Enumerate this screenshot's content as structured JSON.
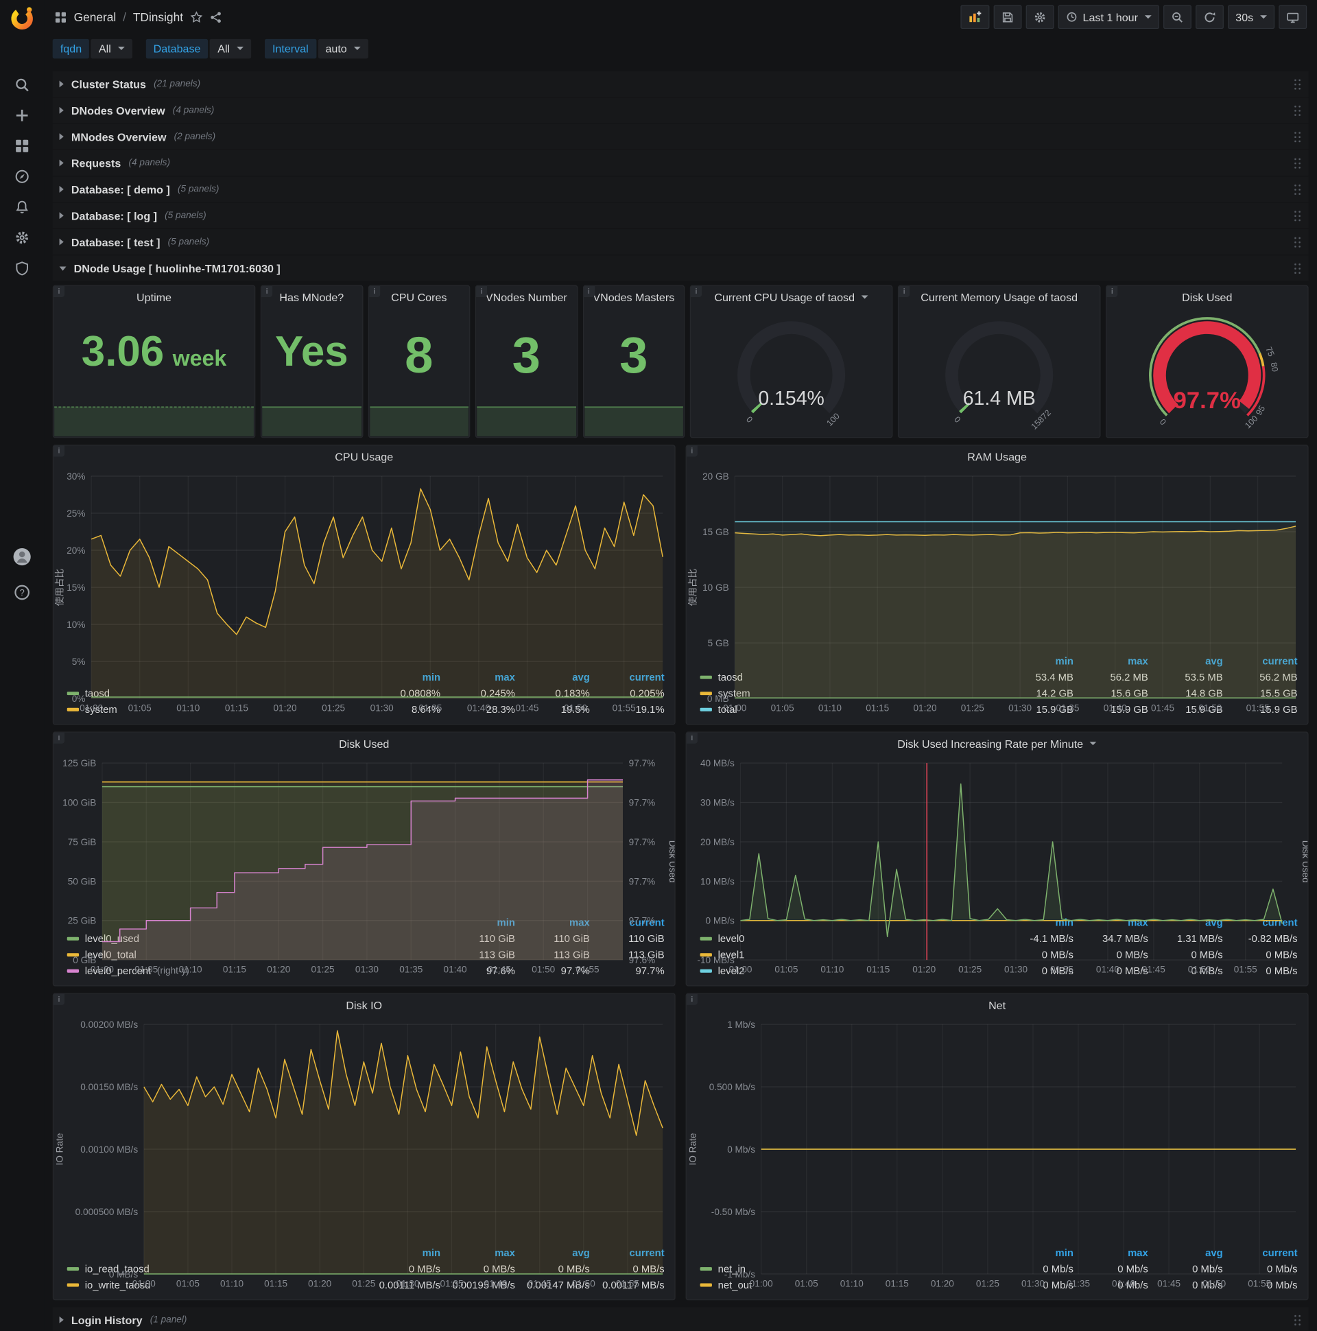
{
  "ui": {
    "info_icon": "i"
  },
  "navbar": {
    "breadcrumb": {
      "section": "General",
      "separator": "/",
      "title": "TDinsight"
    },
    "time_range": "Last 1 hour",
    "refresh_interval": "30s"
  },
  "variables": [
    {
      "label": "fqdn",
      "value": "All"
    },
    {
      "label": "Database",
      "value": "All"
    },
    {
      "label": "Interval",
      "value": "auto"
    }
  ],
  "rows": [
    {
      "title": "Cluster Status",
      "panels": "(21 panels)"
    },
    {
      "title": "DNodes Overview",
      "panels": "(4 panels)"
    },
    {
      "title": "MNodes Overview",
      "panels": "(2 panels)"
    },
    {
      "title": "Requests",
      "panels": "(4 panels)"
    },
    {
      "title": "Database: [ demo ]",
      "panels": "(5 panels)"
    },
    {
      "title": "Database: [ log ]",
      "panels": "(5 panels)"
    },
    {
      "title": "Database: [ test ]",
      "panels": "(5 panels)"
    }
  ],
  "expanded_row": {
    "title": "DNode Usage [ huolinhe-TM1701:6030 ]"
  },
  "login_row": {
    "title": "Login History",
    "panels": "(1 panel)"
  },
  "stats": [
    {
      "title": "Uptime",
      "value": "3.06",
      "unit": "week"
    },
    {
      "title": "Has MNode?",
      "value": "Yes"
    },
    {
      "title": "CPU Cores",
      "value": "8"
    },
    {
      "title": "VNodes Number",
      "value": "3"
    },
    {
      "title": "VNodes Masters",
      "value": "3"
    }
  ],
  "gauges": [
    {
      "title": "Current CPU Usage of taosd",
      "value": "0.154%",
      "min": "0",
      "max": "100",
      "pct": 0.00154,
      "color": "#73bf69",
      "value_color": "#d8d9da"
    },
    {
      "title": "Current Memory Usage of taosd",
      "value": "61.4 MB",
      "min": "0",
      "max": "15872",
      "pct": 0.004,
      "color": "#73bf69",
      "value_color": "#d8d9da"
    },
    {
      "title": "Disk Used",
      "value": "97.7%",
      "min": "0",
      "pct": 0.977,
      "color": "#e02f44",
      "value_color": "#e02f44",
      "thresholds": [
        {
          "t": 0.75,
          "l": "75"
        },
        {
          "t": 0.8,
          "l": "80"
        },
        {
          "t": 0.95,
          "l": "95"
        },
        {
          "t": 1,
          "l": "100"
        }
      ],
      "bands": [
        {
          "from": 0,
          "to": 0.75,
          "color": "#7eb26d"
        },
        {
          "from": 0.75,
          "to": 0.8,
          "color": "#eab839"
        },
        {
          "from": 0.8,
          "to": 1,
          "color": "#e02f44"
        }
      ]
    }
  ],
  "time_ticks": [
    "01:00",
    "01:05",
    "01:10",
    "01:15",
    "01:20",
    "01:25",
    "01:30",
    "01:35",
    "01:40",
    "01:45",
    "01:50",
    "01:55"
  ],
  "chart_data": [
    {
      "type": "line",
      "title": "CPU Usage",
      "ylabel": "使用占比",
      "ylim": [
        0,
        30
      ],
      "yticks": [
        {
          "v": 0,
          "l": "0%"
        },
        {
          "v": 5,
          "l": "5%"
        },
        {
          "v": 10,
          "l": "10%"
        },
        {
          "v": 15,
          "l": "15%"
        },
        {
          "v": 20,
          "l": "20%"
        },
        {
          "v": 25,
          "l": "25%"
        },
        {
          "v": 30,
          "l": "30%"
        }
      ],
      "series": [
        {
          "name": "system",
          "color": "#eab839",
          "fill": 0.1,
          "values": [
            21.5,
            22,
            18,
            16.5,
            20,
            21.5,
            19,
            15,
            20.5,
            19.5,
            18.5,
            17.5,
            16,
            11.5,
            10,
            8.64,
            11,
            10.2,
            9.6,
            14.5,
            22.5,
            24.5,
            18,
            15.5,
            21,
            24.5,
            19,
            22,
            24.5,
            20,
            18.5,
            23,
            17.5,
            21,
            28.3,
            25.5,
            20,
            21.5,
            19,
            16,
            22,
            27,
            21,
            18.5,
            23.5,
            19,
            17,
            20,
            18,
            22,
            26,
            20,
            17.5,
            23,
            20.5,
            26.5,
            22,
            27.5,
            26,
            19.1
          ]
        },
        {
          "name": "taosd",
          "color": "#7eb26d",
          "fill": 0.08,
          "const": 0.2,
          "n": 60
        }
      ],
      "legend": {
        "headers": [
          "min",
          "max",
          "avg",
          "current"
        ],
        "rows": [
          {
            "name": "taosd",
            "color": "#7eb26d",
            "values": [
              "0.0808%",
              "0.245%",
              "0.183%",
              "0.205%"
            ]
          },
          {
            "name": "system",
            "color": "#eab839",
            "values": [
              "8.64%",
              "28.3%",
              "19.5%",
              "19.1%"
            ]
          }
        ]
      }
    },
    {
      "type": "line",
      "title": "RAM Usage",
      "ylabel": "使用占比",
      "ylim": [
        0,
        20
      ],
      "yticks": [
        {
          "v": 0,
          "l": "0 MB"
        },
        {
          "v": 5,
          "l": "5 GB"
        },
        {
          "v": 10,
          "l": "10 GB"
        },
        {
          "v": 15,
          "l": "15 GB"
        },
        {
          "v": 20,
          "l": "20 GB"
        }
      ],
      "series": [
        {
          "name": "system",
          "color": "#eab839",
          "fill": 0.12,
          "values": [
            14.9,
            14.85,
            14.8,
            14.75,
            14.8,
            14.7,
            14.75,
            14.8,
            14.7,
            14.65,
            14.7,
            14.75,
            14.7,
            14.72,
            14.68,
            14.7,
            14.75,
            14.7,
            14.72,
            14.7,
            14.68,
            14.72,
            14.7,
            14.75,
            14.72,
            14.7,
            14.73,
            14.75,
            14.7,
            14.72,
            14.9,
            14.92,
            14.88,
            14.9,
            14.95,
            14.9,
            14.92,
            14.95,
            14.9,
            14.93,
            14.95,
            14.92,
            14.9,
            14.95,
            15.0,
            14.98,
            15.0,
            15.02,
            15.0,
            15.05,
            15.0,
            15.02,
            15.05,
            15.1,
            15.08,
            15.1,
            15.12,
            15.15,
            15.3,
            15.5
          ]
        },
        {
          "name": "total",
          "color": "#6ed0e0",
          "fill": 0.05,
          "const": 15.9,
          "n": 60
        },
        {
          "name": "taosd",
          "color": "#7eb26d",
          "fill": 0.08,
          "const": 0.054,
          "n": 60
        }
      ],
      "legend": {
        "headers": [
          "min",
          "max",
          "avg",
          "current"
        ],
        "rows": [
          {
            "name": "taosd",
            "color": "#7eb26d",
            "values": [
              "53.4 MB",
              "56.2 MB",
              "53.5 MB",
              "56.2 MB"
            ]
          },
          {
            "name": "system",
            "color": "#eab839",
            "values": [
              "14.2 GB",
              "15.6 GB",
              "14.8 GB",
              "15.5 GB"
            ]
          },
          {
            "name": "total",
            "color": "#6ed0e0",
            "values": [
              "15.9 GB",
              "15.9 GB",
              "15.9 GB",
              "15.9 GB"
            ]
          }
        ]
      }
    },
    {
      "type": "line",
      "title": "Disk Used",
      "ylim": [
        0,
        125
      ],
      "yticks": [
        {
          "v": 0,
          "l": "0 GiB"
        },
        {
          "v": 25,
          "l": "25 GiB"
        },
        {
          "v": 50,
          "l": "50 GiB"
        },
        {
          "v": 75,
          "l": "75 GiB"
        },
        {
          "v": 100,
          "l": "100 GiB"
        },
        {
          "v": 125,
          "l": "125 GiB"
        }
      ],
      "right_ticks": [
        "97.6%",
        "97.7%",
        "97.7%",
        "97.7%",
        "97.7%",
        "97.7%"
      ],
      "right_label": "Disk Used",
      "series": [
        {
          "name": "level0_total",
          "color": "#eab839",
          "fill": 0.1,
          "const": 113,
          "n": 60
        },
        {
          "name": "level0_used",
          "color": "#7eb26d",
          "fill": 0.12,
          "const": 110,
          "n": 60
        },
        {
          "name": "level0_percent",
          "color": "#d683ce",
          "fill": 0.12,
          "step": true,
          "range": [
            97.59,
            97.73
          ],
          "values": [
            97.603,
            97.603,
            97.612,
            97.612,
            97.612,
            97.618,
            97.618,
            97.618,
            97.618,
            97.618,
            97.627,
            97.627,
            97.627,
            97.638,
            97.638,
            97.652,
            97.652,
            97.652,
            97.652,
            97.652,
            97.655,
            97.655,
            97.655,
            97.658,
            97.658,
            97.67,
            97.67,
            97.67,
            97.67,
            97.67,
            97.672,
            97.672,
            97.672,
            97.672,
            97.672,
            97.703,
            97.703,
            97.703,
            97.703,
            97.703,
            97.705,
            97.705,
            97.705,
            97.705,
            97.705,
            97.705,
            97.705,
            97.705,
            97.705,
            97.705,
            97.705,
            97.705,
            97.705,
            97.705,
            97.705,
            97.718,
            97.718,
            97.718,
            97.718,
            97.718
          ]
        }
      ],
      "legend": {
        "headers": [
          "min",
          "max",
          "current"
        ],
        "rows": [
          {
            "name": "level0_used",
            "color": "#7eb26d",
            "values": [
              "110 GiB",
              "110 GiB",
              "110 GiB"
            ]
          },
          {
            "name": "level0_total",
            "color": "#eab839",
            "values": [
              "113 GiB",
              "113 GiB",
              "113 GiB"
            ]
          },
          {
            "name": "level0_percent",
            "suffix": "(right-y)",
            "color": "#d683ce",
            "values": [
              "97.6%",
              "97.7%",
              "97.7%"
            ]
          }
        ]
      }
    },
    {
      "type": "line",
      "title": "Disk Used Increasing Rate per Minute",
      "has_menu": true,
      "ylim": [
        -10,
        40
      ],
      "yticks": [
        {
          "v": -10,
          "l": "-10 MB/s"
        },
        {
          "v": 0,
          "l": "0 MB/s"
        },
        {
          "v": 10,
          "l": "10 MB/s"
        },
        {
          "v": 20,
          "l": "20 MB/s"
        },
        {
          "v": 30,
          "l": "30 MB/s"
        },
        {
          "v": 40,
          "l": "40 MB/s"
        }
      ],
      "right_label": "Disk Used",
      "annotation_x": 20.3,
      "series": [
        {
          "name": "level2",
          "color": "#6ed0e0",
          "const": 0,
          "n": 60
        },
        {
          "name": "level1",
          "color": "#eab839",
          "const": 0,
          "n": 60
        },
        {
          "name": "level0",
          "color": "#7eb26d",
          "fill": 0.12,
          "values": [
            0,
            0.3,
            17,
            0.5,
            0,
            0.2,
            11.5,
            0.4,
            0,
            0.2,
            0,
            0.3,
            0,
            0.2,
            0,
            20,
            -4.1,
            13,
            0.3,
            0,
            0.2,
            0,
            0.3,
            0,
            34.7,
            0.5,
            0,
            0.3,
            3,
            0.2,
            0,
            0.3,
            0,
            0.2,
            20,
            0.4,
            0,
            0.3,
            0,
            0.2,
            0,
            0.3,
            0,
            0.2,
            0,
            0.3,
            0,
            0.2,
            0,
            0.3,
            0,
            0.2,
            0,
            0.3,
            0,
            0.2,
            0,
            0.3,
            8,
            -0.82
          ]
        }
      ],
      "legend": {
        "headers": [
          "min",
          "max",
          "avg",
          "current"
        ],
        "rows": [
          {
            "name": "level0",
            "color": "#7eb26d",
            "values": [
              "-4.1 MB/s",
              "34.7 MB/s",
              "1.31 MB/s",
              "-0.82 MB/s"
            ]
          },
          {
            "name": "level1",
            "color": "#eab839",
            "values": [
              "0 MB/s",
              "0 MB/s",
              "0 MB/s",
              "0 MB/s"
            ]
          },
          {
            "name": "level2",
            "color": "#6ed0e0",
            "values": [
              "0 MB/s",
              "0 MB/s",
              "0 MB/s",
              "0 MB/s"
            ]
          }
        ]
      }
    },
    {
      "type": "line",
      "title": "Disk IO",
      "ylabel": "IO Rate",
      "ylim": [
        0,
        0.002
      ],
      "yticks": [
        {
          "v": 0,
          "l": "0 MB/s"
        },
        {
          "v": 0.0005,
          "l": "0.000500 MB/s"
        },
        {
          "v": 0.001,
          "l": "0.00100 MB/s"
        },
        {
          "v": 0.0015,
          "l": "0.00150 MB/s"
        },
        {
          "v": 0.002,
          "l": "0.00200 MB/s"
        }
      ],
      "series": [
        {
          "name": "io_write_taosd",
          "color": "#eab839",
          "fill": 0.1,
          "values": [
            0.0015,
            0.00138,
            0.00152,
            0.0014,
            0.00148,
            0.00135,
            0.00158,
            0.00142,
            0.0015,
            0.00136,
            0.0016,
            0.00145,
            0.0013,
            0.00165,
            0.00148,
            0.00125,
            0.00172,
            0.0015,
            0.00128,
            0.0018,
            0.00155,
            0.00132,
            0.00195,
            0.0016,
            0.00135,
            0.0017,
            0.00145,
            0.00185,
            0.0015,
            0.00128,
            0.00175,
            0.00148,
            0.0013,
            0.00168,
            0.00152,
            0.00135,
            0.00178,
            0.00142,
            0.00125,
            0.00182,
            0.00155,
            0.0013,
            0.0017,
            0.00148,
            0.00132,
            0.0019,
            0.00158,
            0.00128,
            0.00165,
            0.0015,
            0.00135,
            0.00175,
            0.00145,
            0.00125,
            0.00168,
            0.0014,
            0.00111,
            0.00155,
            0.00135,
            0.00117
          ]
        },
        {
          "name": "io_read_taosd",
          "color": "#7eb26d",
          "fill": 0.05,
          "const": 0,
          "n": 60
        }
      ],
      "legend": {
        "headers": [
          "min",
          "max",
          "avg",
          "current"
        ],
        "rows": [
          {
            "name": "io_read_taosd",
            "color": "#7eb26d",
            "values": [
              "0 MB/s",
              "0 MB/s",
              "0 MB/s",
              "0 MB/s"
            ]
          },
          {
            "name": "io_write_taosd",
            "color": "#eab839",
            "values": [
              "0.00111 MB/s",
              "0.00195 MB/s",
              "0.00147 MB/s",
              "0.00117 MB/s"
            ]
          }
        ]
      }
    },
    {
      "type": "line",
      "title": "Net",
      "ylabel": "IO Rate",
      "ylim": [
        -1,
        1
      ],
      "yticks": [
        {
          "v": -1,
          "l": "-1 Mb/s"
        },
        {
          "v": -0.5,
          "l": "-0.50 Mb/s"
        },
        {
          "v": 0,
          "l": "0 Mb/s"
        },
        {
          "v": 0.5,
          "l": "0.500 Mb/s"
        },
        {
          "v": 1,
          "l": "1 Mb/s"
        }
      ],
      "series": [
        {
          "name": "net_in",
          "color": "#7eb26d",
          "const": 0,
          "n": 60
        },
        {
          "name": "net_out",
          "color": "#eab839",
          "const": 0,
          "n": 60
        }
      ],
      "legend": {
        "headers": [
          "min",
          "max",
          "avg",
          "current"
        ],
        "rows": [
          {
            "name": "net_in",
            "color": "#7eb26d",
            "values": [
              "0 Mb/s",
              "0 Mb/s",
              "0 Mb/s",
              "0 Mb/s"
            ]
          },
          {
            "name": "net_out",
            "color": "#eab839",
            "values": [
              "0 Mb/s",
              "0 Mb/s",
              "0 Mb/s",
              "0 Mb/s"
            ]
          }
        ]
      }
    }
  ]
}
